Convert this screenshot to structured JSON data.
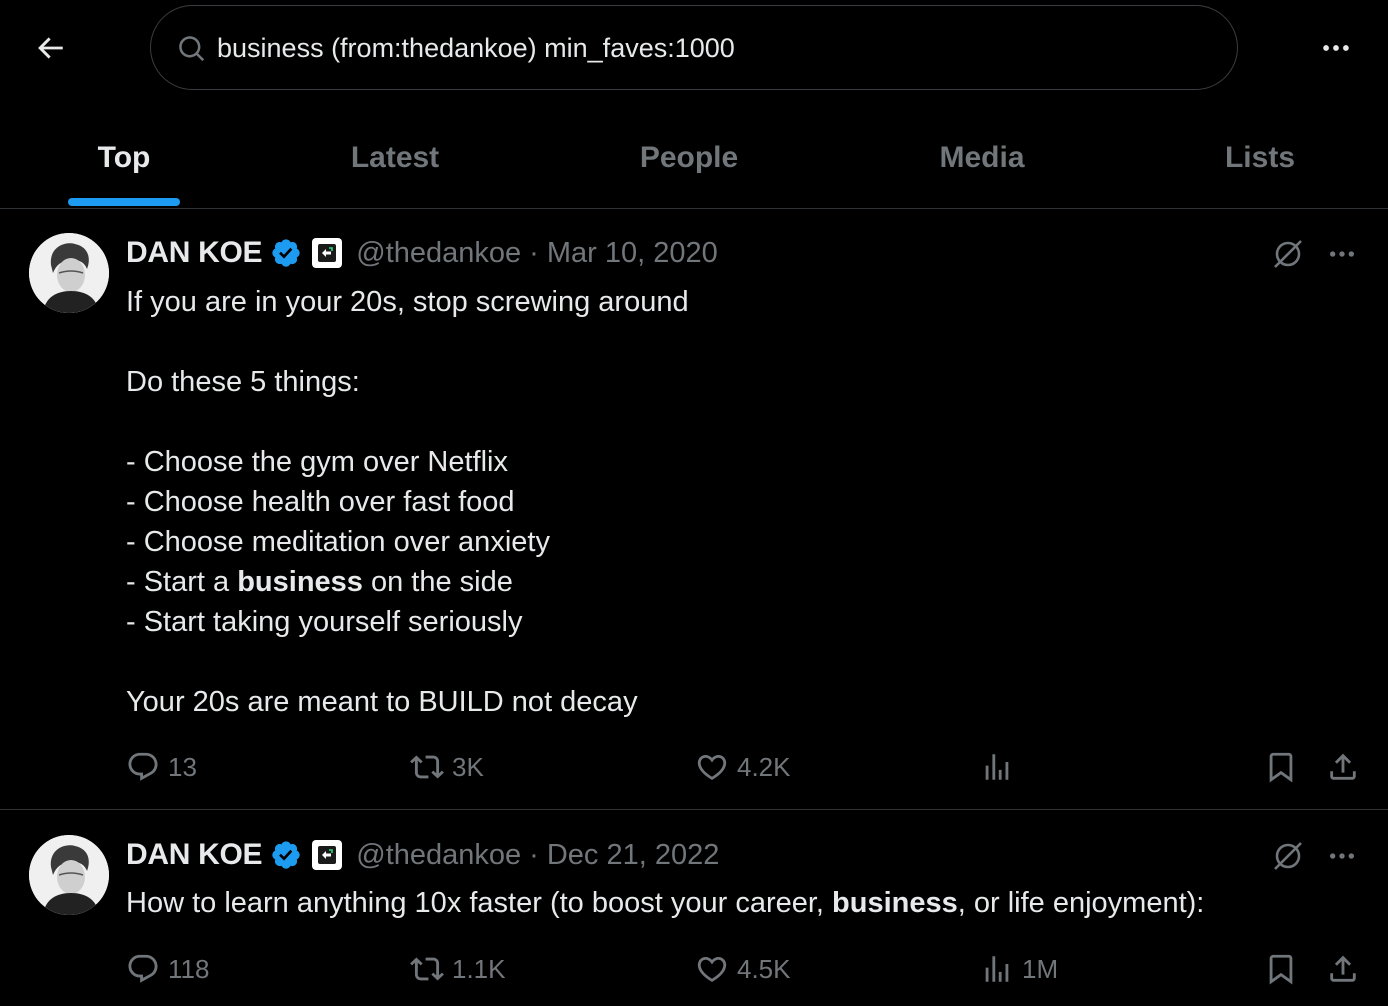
{
  "search": {
    "value": "business (from:thedankoe) min_faves:1000",
    "placeholder": "Search"
  },
  "tabs": [
    {
      "label": "Top",
      "active": true
    },
    {
      "label": "Latest"
    },
    {
      "label": "People"
    },
    {
      "label": "Media"
    },
    {
      "label": "Lists"
    }
  ],
  "colors": {
    "accent": "#1d9bf0",
    "muted": "#71767b",
    "text": "#e7e9ea",
    "border": "#2f3336"
  },
  "tweets": [
    {
      "author": "DAN KOE",
      "handle": "@thedankoe",
      "separator": "·",
      "date": "Mar 10, 2020",
      "lines": {
        "l1": "If you are in your 20s, stop screwing around",
        "l2": "Do these 5 things:",
        "l3": "- Choose the gym over Netflix",
        "l4": "- Choose health over fast food",
        "l5": "- Choose meditation over anxiety",
        "l6a": "- Start a ",
        "l6b": "business",
        "l6c": " on the side",
        "l7": "- Start taking yourself seriously",
        "l8": "Your 20s are meant to BUILD not decay"
      },
      "stats": {
        "replies": "13",
        "reposts": "3K",
        "likes": "4.2K",
        "views": ""
      }
    },
    {
      "author": "DAN KOE",
      "handle": "@thedankoe",
      "separator": "·",
      "date": "Dec 21, 2022",
      "lines": {
        "l1a": "How to learn anything 10x faster (to boost your career, ",
        "l1b": "business",
        "l1c": ", or life enjoyment):"
      },
      "stats": {
        "replies": "118",
        "reposts": "1.1K",
        "likes": "4.5K",
        "views": "1M"
      }
    }
  ],
  "icons": [
    "back-arrow-icon",
    "search-icon",
    "more-icon",
    "verified-badge-icon",
    "affiliate-badge-icon",
    "grok-icon",
    "reply-icon",
    "repost-icon",
    "like-icon",
    "views-icon",
    "bookmark-icon",
    "share-icon"
  ]
}
